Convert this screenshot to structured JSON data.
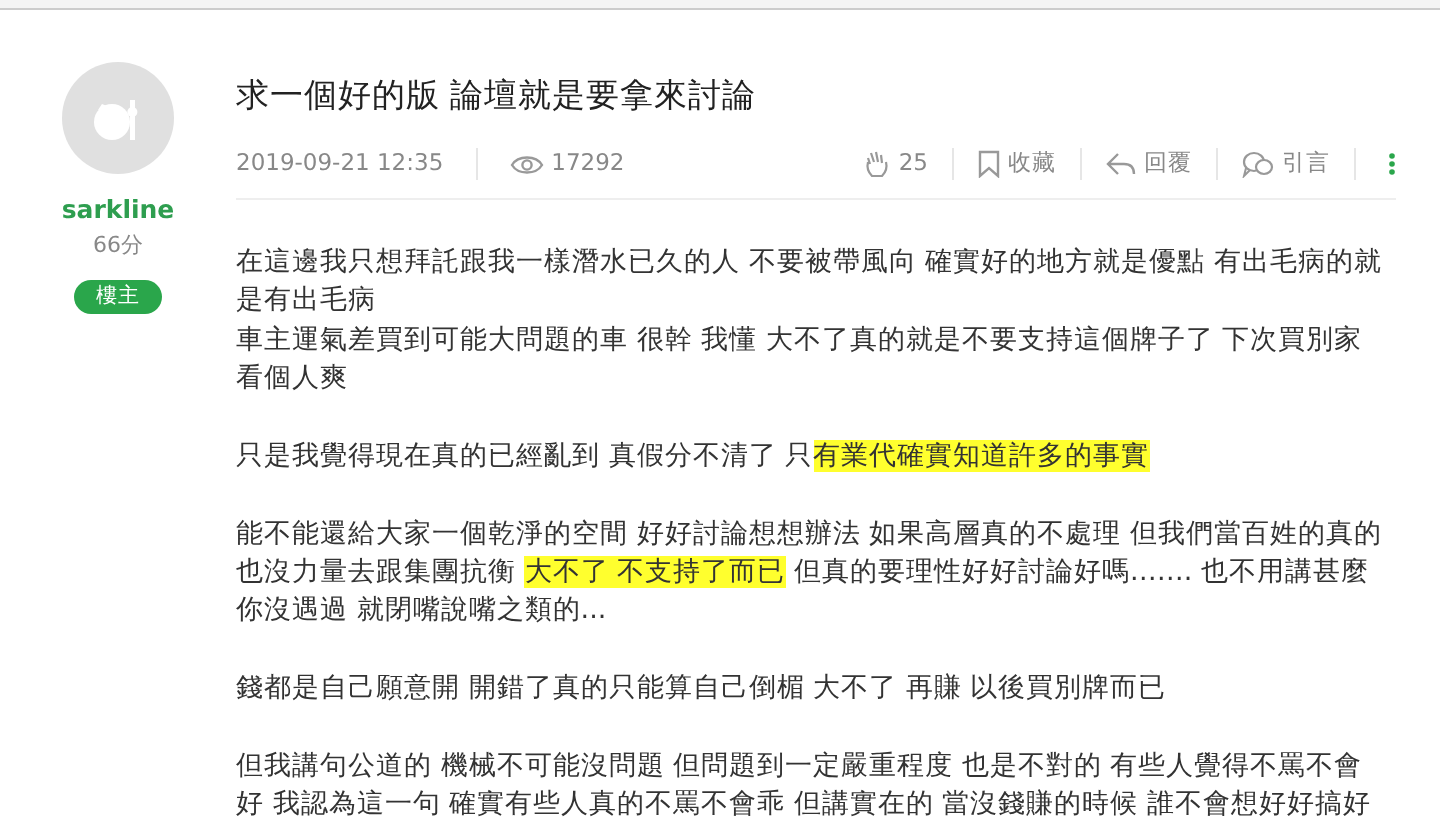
{
  "author": {
    "name": "sarkline",
    "score": "66分",
    "badge": "樓主"
  },
  "post": {
    "title": "求一個好的版 論壇就是要拿來討論",
    "date": "2019-09-21 12:35",
    "views": "17292",
    "actions": [
      {
        "kind": "clap",
        "label": "25"
      },
      {
        "kind": "bookmark",
        "label": "收藏"
      },
      {
        "kind": "reply",
        "label": "回覆"
      },
      {
        "kind": "quote",
        "label": "引言"
      }
    ],
    "paragraphs": [
      [
        [
          {
            "text": "在這邊我只想拜託跟我一樣潛水已久的人 不要被帶風向 確實好的地方就是優點 有出毛病的就是有出毛病",
            "highlight": false
          }
        ],
        [
          {
            "text": "車主運氣差買到可能大問題的車 很幹 我懂 大不了真的就是不要支持這個牌子了 下次買別家看個人爽",
            "highlight": false
          }
        ]
      ],
      [
        [
          {
            "text": "只是我覺得現在真的已經亂到 真假分不清了 只",
            "highlight": false
          },
          {
            "text": "有業代確實知道許多的事實",
            "highlight": true
          }
        ]
      ],
      [
        [
          {
            "text": "能不能還給大家一個乾淨的空間 好好討論想想辦法 如果高層真的不處理 但我們當百姓的真的也沒力量去跟集團抗衡 ",
            "highlight": false
          },
          {
            "text": "大不了 不支持了而已",
            "highlight": true
          },
          {
            "text": " 但真的要理性好好討論好嗎……. 也不用講甚麼你沒遇過 就閉嘴說嘴之類的...",
            "highlight": false
          }
        ]
      ],
      [
        [
          {
            "text": "錢都是自己願意開 開錯了真的只能算自己倒楣 大不了 再賺 以後買別牌而已",
            "highlight": false
          }
        ]
      ],
      [
        [
          {
            "text": "但我講句公道的 機械不可能沒問題 但問題到一定嚴重程度 也是不對的 有些人覺得不罵不會好 我認為這一句 確實有些人真的不罵不會乖 但講實在的 當沒錢賺的時候 誰不會想好好搞好",
            "highlight": false
          }
        ]
      ]
    ]
  }
}
